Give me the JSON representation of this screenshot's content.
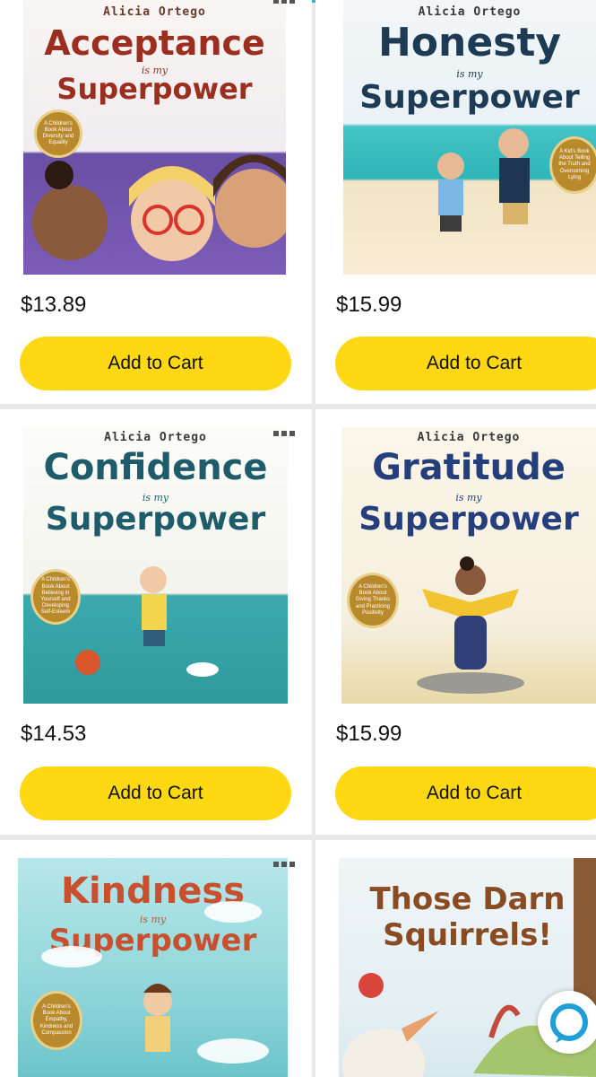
{
  "products": [
    {
      "author": "Alicia Ortego",
      "title": "Acceptance",
      "subtitle_small": "is my",
      "subtitle": "Superpower",
      "badge": "A Children's Book About Diversity and Equality",
      "price": "$13.89",
      "button": "Add to Cart",
      "title_color": "#9b2e1f"
    },
    {
      "author": "Alicia Ortego",
      "title": "Honesty",
      "subtitle_small": "is my",
      "subtitle": "Superpower",
      "badge": "A Kid's Book About Telling the Truth and Overcoming Lying",
      "price": "$15.99",
      "button": "Add to Cart",
      "title_color": "#1d3b55"
    },
    {
      "author": "Alicia Ortego",
      "title": "Confidence",
      "subtitle_small": "is my",
      "subtitle": "Superpower",
      "badge": "A Children's Book About Believing in Yourself and Developing Self-Esteem",
      "price": "$14.53",
      "button": "Add to Cart",
      "title_color": "#1f5c6b"
    },
    {
      "author": "Alicia Ortego",
      "title": "Gratitude",
      "subtitle_small": "is my",
      "subtitle": "Superpower",
      "badge": "A Children's Book About Giving Thanks and Practicing Positivity",
      "price": "$15.99",
      "button": "Add to Cart",
      "title_color": "#253f7c"
    },
    {
      "title": "Kindness",
      "subtitle_small": "is my",
      "subtitle": "Superpower",
      "badge": "A Children's Book About Empathy, Kindness and Compassion",
      "title_color": "#c9502e"
    },
    {
      "title_line1": "Those Darn",
      "title_line2": "Squirrels!",
      "title_color": "#8a4a22"
    }
  ],
  "colors": {
    "button": "#ffd814",
    "alexa": "#1f9fd6"
  },
  "icons": {
    "more": "more-options-icon",
    "assistant": "alexa-icon"
  }
}
